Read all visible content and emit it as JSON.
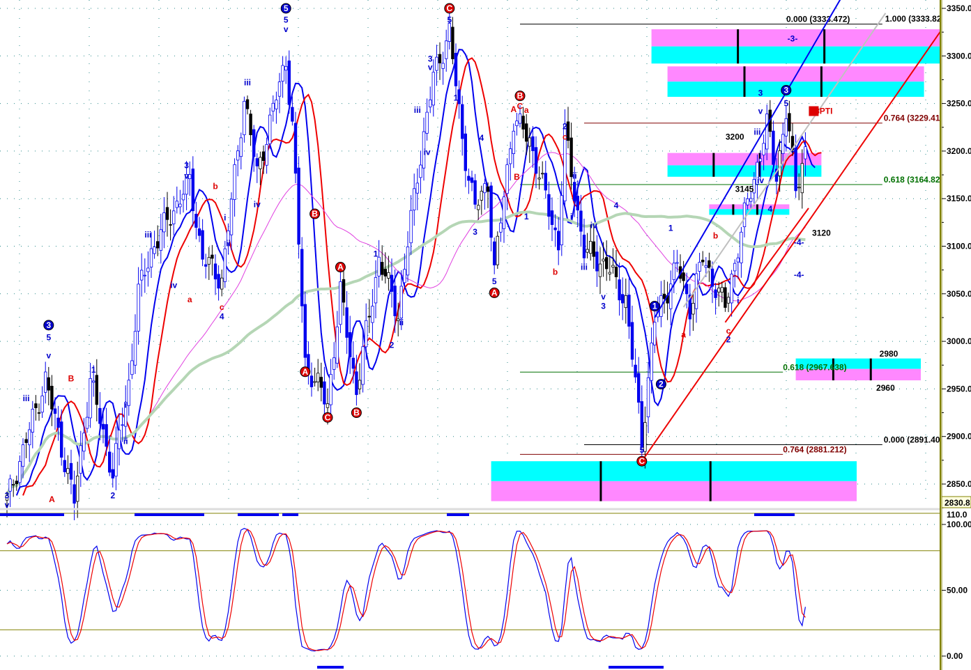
{
  "chart_data": {
    "type": "candlestick",
    "price_axis": {
      "min": 2830,
      "max": 3350,
      "ticks": [
        3350,
        3300,
        3250,
        3200,
        3150,
        3100,
        3050,
        3000,
        2950,
        2900,
        2850
      ],
      "tick_labels": [
        "3350.0",
        "3300.0",
        "3250.0",
        "3200.0",
        "3150.0",
        "3100.0",
        "3050.0",
        "3000.0",
        "2950.0",
        "2900.0",
        "2850.0"
      ],
      "current_value_label": "2830.8"
    },
    "oscillator_axis": {
      "min": 0,
      "max": 110,
      "tick_labels": [
        "110.0",
        "100.00",
        "50.00",
        "0.00"
      ],
      "ticks": [
        110,
        100,
        50,
        0
      ],
      "levels": [
        80,
        20
      ]
    },
    "bar_count": 250,
    "price_path": [
      [
        0,
        2832
      ],
      [
        12,
        2960
      ],
      [
        21,
        2832
      ],
      [
        26,
        2960
      ],
      [
        33,
        2861
      ],
      [
        38,
        2956
      ],
      [
        41,
        3051
      ],
      [
        45,
        3095
      ],
      [
        52,
        3139
      ],
      [
        57,
        3168
      ],
      [
        61,
        3087
      ],
      [
        67,
        3065
      ],
      [
        74,
        3256
      ],
      [
        78,
        3176
      ],
      [
        87,
        3297
      ],
      [
        89,
        3227
      ],
      [
        93,
        2978
      ],
      [
        100,
        2934
      ],
      [
        104,
        3051
      ],
      [
        109,
        2948
      ],
      [
        116,
        3087
      ],
      [
        122,
        3029
      ],
      [
        128,
        3176
      ],
      [
        133,
        3278
      ],
      [
        138,
        3326
      ],
      [
        142,
        3212
      ],
      [
        146,
        3139
      ],
      [
        150,
        3168
      ],
      [
        152,
        3073
      ],
      [
        158,
        3234
      ],
      [
        163,
        3212
      ],
      [
        172,
        3102
      ],
      [
        174,
        3219
      ],
      [
        180,
        3095
      ],
      [
        187,
        3080
      ],
      [
        193,
        3043
      ],
      [
        198,
        2897
      ],
      [
        202,
        3022
      ],
      [
        209,
        3080
      ],
      [
        213,
        3036
      ],
      [
        217,
        3087
      ],
      [
        224,
        3036
      ],
      [
        230,
        3131
      ],
      [
        237,
        3227
      ],
      [
        240,
        3176
      ],
      [
        243,
        3241
      ],
      [
        246,
        3161
      ],
      [
        249,
        3201
      ]
    ],
    "series": [
      {
        "name": "fast-average",
        "color": "#0000ee",
        "period": 5,
        "shift": 3
      },
      {
        "name": "slow-average",
        "color": "#ee0000",
        "period": 8,
        "shift": 5
      },
      {
        "name": "medium-average",
        "color": "#e040e0",
        "period": 45,
        "shift": 0
      },
      {
        "name": "long-average",
        "color": "#b5d6b5",
        "period": 90,
        "shift": 0
      }
    ],
    "oscillator_series": [
      {
        "name": "stochastic-k",
        "color": "#0000ee"
      },
      {
        "name": "stochastic-d",
        "color": "#ee0000"
      }
    ],
    "fib_levels": [
      {
        "text": "0.000 (3333.472)",
        "price": 3333.472,
        "from_bar": 160,
        "to_bar": 273,
        "color": "#000000"
      },
      {
        "text": "1.000 (3333.82",
        "price": 3333.82,
        "from_bar": 273,
        "to_bar": 273,
        "color": "#000000"
      },
      {
        "text": "0.764 (3229.41",
        "price": 3229.41,
        "from_bar": 180,
        "to_bar": 273,
        "color": "#800000"
      },
      {
        "text": "0.618 (3164.82",
        "price": 3164.82,
        "from_bar": 160,
        "to_bar": 273,
        "color": "#007000"
      },
      {
        "text": "0.618 (2967.638)",
        "price": 2967.638,
        "from_bar": 160,
        "to_bar": 242,
        "color": "#007000"
      },
      {
        "text": "0.000 (2891.40",
        "price": 2891.4,
        "from_bar": 180,
        "to_bar": 273,
        "color": "#000000"
      },
      {
        "text": "0.764 (2881.212)",
        "price": 2881.212,
        "from_bar": 160,
        "to_bar": 242,
        "color": "#800000"
      }
    ],
    "zones": [
      {
        "from_bar": 201,
        "to_bar": 292,
        "top": 3328,
        "mid": 3310,
        "bottom": 3292,
        "upper": "magenta",
        "lower": "cyan"
      },
      {
        "from_bar": 206,
        "to_bar": 286,
        "top": 3289,
        "mid": 3273,
        "bottom": 3257,
        "upper": "magenta",
        "lower": "cyan"
      },
      {
        "from_bar": 206,
        "to_bar": 254,
        "top": 3198,
        "mid": 3185,
        "bottom": 3173,
        "upper": "magenta",
        "lower": "cyan"
      },
      {
        "from_bar": 219,
        "to_bar": 244,
        "top": 3144,
        "mid": 3139,
        "bottom": 3133,
        "upper": "magenta",
        "lower": "cyan"
      },
      {
        "from_bar": 246,
        "to_bar": 285,
        "top": 2982,
        "mid": 2971,
        "bottom": 2959,
        "upper": "cyan",
        "lower": "magenta"
      },
      {
        "from_bar": 151,
        "to_bar": 265,
        "top": 2874,
        "mid": 2853,
        "bottom": 2832,
        "upper": "cyan",
        "lower": "magenta"
      }
    ],
    "trend_lines": [
      {
        "color": "#0000ee",
        "from": [
          202,
          3025
        ],
        "to": [
          260,
          3360
        ]
      },
      {
        "color": "#ee0000",
        "from": [
          198,
          2874
        ],
        "to": [
          292,
          3330
        ]
      },
      {
        "color": "#ee0000",
        "from": [
          224,
          3020
        ],
        "to": [
          250,
          3140
        ]
      },
      {
        "color": "#c0c0c0",
        "from": [
          211,
          3036
        ],
        "to": [
          274,
          3345
        ]
      }
    ],
    "annotations": [
      {
        "bar": 0,
        "price": 2838,
        "text": "3",
        "color": "blue"
      },
      {
        "bar": 0,
        "price": 2828,
        "text": "v",
        "color": "blue"
      },
      {
        "bar": 13,
        "price": 3017,
        "text": "3",
        "color": "blue",
        "circle": true
      },
      {
        "bar": 13,
        "price": 3004,
        "text": "5",
        "color": "blue"
      },
      {
        "bar": 13,
        "price": 2985,
        "text": "v",
        "color": "blue"
      },
      {
        "bar": 6,
        "price": 2940,
        "text": "iii",
        "color": "blue"
      },
      {
        "bar": 20,
        "price": 2961,
        "text": "B",
        "color": "red"
      },
      {
        "bar": 14,
        "price": 2834,
        "text": "A",
        "color": "red"
      },
      {
        "bar": 27,
        "price": 2970,
        "text": "1",
        "color": "blue"
      },
      {
        "bar": 33,
        "price": 2838,
        "text": "2",
        "color": "blue"
      },
      {
        "bar": 37,
        "price": 2933,
        "text": "i",
        "color": "blue"
      },
      {
        "bar": 37,
        "price": 2895,
        "text": "ii",
        "color": "blue"
      },
      {
        "bar": 44,
        "price": 3112,
        "text": "iii",
        "color": "blue"
      },
      {
        "bar": 52,
        "price": 3059,
        "text": "iv",
        "color": "blue"
      },
      {
        "bar": 57,
        "price": 3044,
        "text": "a",
        "color": "red"
      },
      {
        "bar": 56,
        "price": 3185,
        "text": "3",
        "color": "blue"
      },
      {
        "bar": 56,
        "price": 3174,
        "text": "v",
        "color": "blue"
      },
      {
        "bar": 65,
        "price": 3163,
        "text": "b",
        "color": "red"
      },
      {
        "bar": 68,
        "price": 3130,
        "text": "i",
        "color": "blue"
      },
      {
        "bar": 69,
        "price": 3103,
        "text": "ii",
        "color": "blue"
      },
      {
        "bar": 67,
        "price": 3036,
        "text": "c",
        "color": "red"
      },
      {
        "bar": 67,
        "price": 3026,
        "text": "4",
        "color": "blue"
      },
      {
        "bar": 75,
        "price": 3272,
        "text": "iii",
        "color": "blue"
      },
      {
        "bar": 78,
        "price": 3144,
        "text": "iv",
        "color": "blue"
      },
      {
        "bar": 87,
        "price": 3350,
        "text": "5",
        "color": "blue",
        "circle": true
      },
      {
        "bar": 87,
        "price": 3338,
        "text": "5",
        "color": "blue"
      },
      {
        "bar": 87,
        "price": 3328,
        "text": "v",
        "color": "blue"
      },
      {
        "bar": 96,
        "price": 3134,
        "text": "B",
        "color": "red",
        "circle": true
      },
      {
        "bar": 104,
        "price": 3078,
        "text": "A",
        "color": "red",
        "circle": true
      },
      {
        "bar": 93,
        "price": 2968,
        "text": "A",
        "color": "red",
        "circle": true
      },
      {
        "bar": 100,
        "price": 2920,
        "text": "C",
        "color": "red",
        "circle": true
      },
      {
        "bar": 109,
        "price": 2925,
        "text": "B",
        "color": "red",
        "circle": true
      },
      {
        "bar": 115,
        "price": 3092,
        "text": "1",
        "color": "blue"
      },
      {
        "bar": 120,
        "price": 2996,
        "text": "2",
        "color": "blue"
      },
      {
        "bar": 123,
        "price": 3020,
        "text": "ii",
        "color": "blue"
      },
      {
        "bar": 132,
        "price": 3297,
        "text": "3",
        "color": "blue"
      },
      {
        "bar": 132,
        "price": 3288,
        "text": "v",
        "color": "blue"
      },
      {
        "bar": 128,
        "price": 3243,
        "text": "iii",
        "color": "blue"
      },
      {
        "bar": 131,
        "price": 3199,
        "text": "iv",
        "color": "blue"
      },
      {
        "bar": 138,
        "price": 3350,
        "text": "C",
        "color": "red",
        "circle": true
      },
      {
        "bar": 138,
        "price": 3338,
        "text": "5",
        "color": "blue"
      },
      {
        "bar": 140,
        "price": 3256,
        "text": "1",
        "color": "blue"
      },
      {
        "bar": 148,
        "price": 3214,
        "text": "4",
        "color": "blue"
      },
      {
        "bar": 146,
        "price": 3115,
        "text": "3",
        "color": "blue"
      },
      {
        "bar": 152,
        "price": 3063,
        "text": "5",
        "color": "blue"
      },
      {
        "bar": 152,
        "price": 3051,
        "text": "A",
        "color": "red",
        "circle": true
      },
      {
        "bar": 160,
        "price": 3258,
        "text": "B",
        "color": "red",
        "circle": true
      },
      {
        "bar": 158,
        "price": 3244,
        "text": "A",
        "color": "red"
      },
      {
        "bar": 160,
        "price": 3247,
        "text": "C",
        "color": "red"
      },
      {
        "bar": 162,
        "price": 3243,
        "text": "a",
        "color": "red"
      },
      {
        "bar": 159,
        "price": 3173,
        "text": "B",
        "color": "red"
      },
      {
        "bar": 162,
        "price": 3131,
        "text": "1",
        "color": "blue"
      },
      {
        "bar": 174,
        "price": 3226,
        "text": "2",
        "color": "blue"
      },
      {
        "bar": 174,
        "price": 3215,
        "text": "c",
        "color": "red"
      },
      {
        "bar": 177,
        "price": 3174,
        "text": "ii",
        "color": "blue"
      },
      {
        "bar": 176,
        "price": 3131,
        "text": "i",
        "color": "blue"
      },
      {
        "bar": 171,
        "price": 3073,
        "text": "b",
        "color": "red"
      },
      {
        "bar": 183,
        "price": 3122,
        "text": "iv",
        "color": "blue"
      },
      {
        "bar": 180,
        "price": 3078,
        "text": "iii",
        "color": "blue"
      },
      {
        "bar": 190,
        "price": 3143,
        "text": "4",
        "color": "blue"
      },
      {
        "bar": 186,
        "price": 3047,
        "text": "v",
        "color": "blue"
      },
      {
        "bar": 186,
        "price": 3037,
        "text": "3",
        "color": "blue"
      },
      {
        "bar": 198,
        "price": 2886,
        "text": "5",
        "color": "blue"
      },
      {
        "bar": 198,
        "price": 2874,
        "text": "C",
        "color": "red",
        "circle": true
      },
      {
        "bar": 202,
        "price": 3037,
        "text": "1",
        "color": "blue",
        "circle": true
      },
      {
        "bar": 204,
        "price": 2955,
        "text": "2",
        "color": "blue",
        "circle": true
      },
      {
        "bar": 207,
        "price": 3119,
        "text": "1",
        "color": "blue"
      },
      {
        "bar": 211,
        "price": 3007,
        "text": "a",
        "color": "red"
      },
      {
        "bar": 221,
        "price": 3111,
        "text": "b",
        "color": "red"
      },
      {
        "bar": 225,
        "price": 3011,
        "text": "c",
        "color": "red"
      },
      {
        "bar": 225,
        "price": 3002,
        "text": "2",
        "color": "blue"
      },
      {
        "bar": 228,
        "price": 3043,
        "text": "i",
        "color": "blue"
      },
      {
        "bar": 234,
        "price": 3220,
        "text": "iii",
        "color": "blue"
      },
      {
        "bar": 235,
        "price": 3242,
        "text": "v",
        "color": "blue"
      },
      {
        "bar": 235,
        "price": 3261,
        "text": "3",
        "color": "blue"
      },
      {
        "bar": 235,
        "price": 3169,
        "text": "iv",
        "color": "blue"
      },
      {
        "bar": 238,
        "price": 3139,
        "text": "4",
        "color": "blue"
      },
      {
        "bar": 243,
        "price": 3264,
        "text": "3",
        "color": "blue",
        "circle": true
      },
      {
        "bar": 243,
        "price": 3250,
        "text": "5",
        "color": "blue"
      },
      {
        "bar": 245,
        "price": 3318,
        "text": "-3-",
        "color": "blue"
      },
      {
        "bar": 247,
        "price": 3104,
        "text": "-4-",
        "color": "blue"
      },
      {
        "bar": 247,
        "price": 3070,
        "text": "-4-",
        "color": "blue"
      },
      {
        "bar": 227,
        "price": 3215,
        "text": "3200",
        "color": "black"
      },
      {
        "bar": 230,
        "price": 3160,
        "text": "3145",
        "color": "black"
      },
      {
        "bar": 254,
        "price": 3114,
        "text": "3120",
        "color": "black"
      },
      {
        "bar": 275,
        "price": 2987,
        "text": "2980",
        "color": "black"
      },
      {
        "bar": 274,
        "price": 2951,
        "text": "2960",
        "color": "black"
      },
      {
        "bar": 254,
        "price": 3242,
        "text": "58PTI",
        "color": "red"
      }
    ]
  }
}
